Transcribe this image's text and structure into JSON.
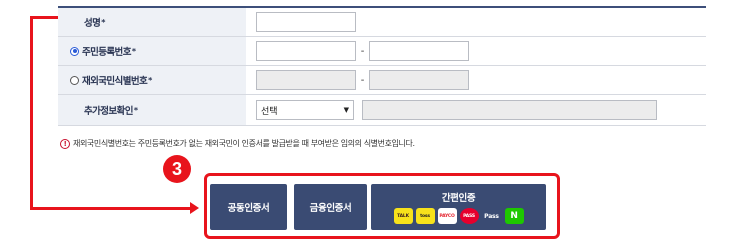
{
  "form": {
    "rows": [
      {
        "label": "성명",
        "star": "*"
      },
      {
        "label": "주민등록번호",
        "star": "*",
        "radio": "checked"
      },
      {
        "label": "재외국민식별번호",
        "star": "*",
        "radio": "unchecked"
      },
      {
        "label": "추가정보확인",
        "star": "*"
      }
    ],
    "dash": "-",
    "select_value": "선택",
    "select_arrow": "▼"
  },
  "notice": {
    "icon": "!",
    "text": "재외국민식별번호는 주민등록번호가 없는 재외국민이 인증서를 발급받을 때 부여받은 임의의 식별번호입니다."
  },
  "annotation": {
    "badge": "3",
    "color": "#e8141c"
  },
  "buttons": {
    "public_cert": "공동인증서",
    "financial_cert": "금융인증서",
    "simple_cert": {
      "title": "간편인증",
      "logos": [
        "TALK",
        "toss",
        "PAYCO",
        "PASS",
        "Pass",
        "N"
      ]
    },
    "color": "#3a4b73"
  }
}
